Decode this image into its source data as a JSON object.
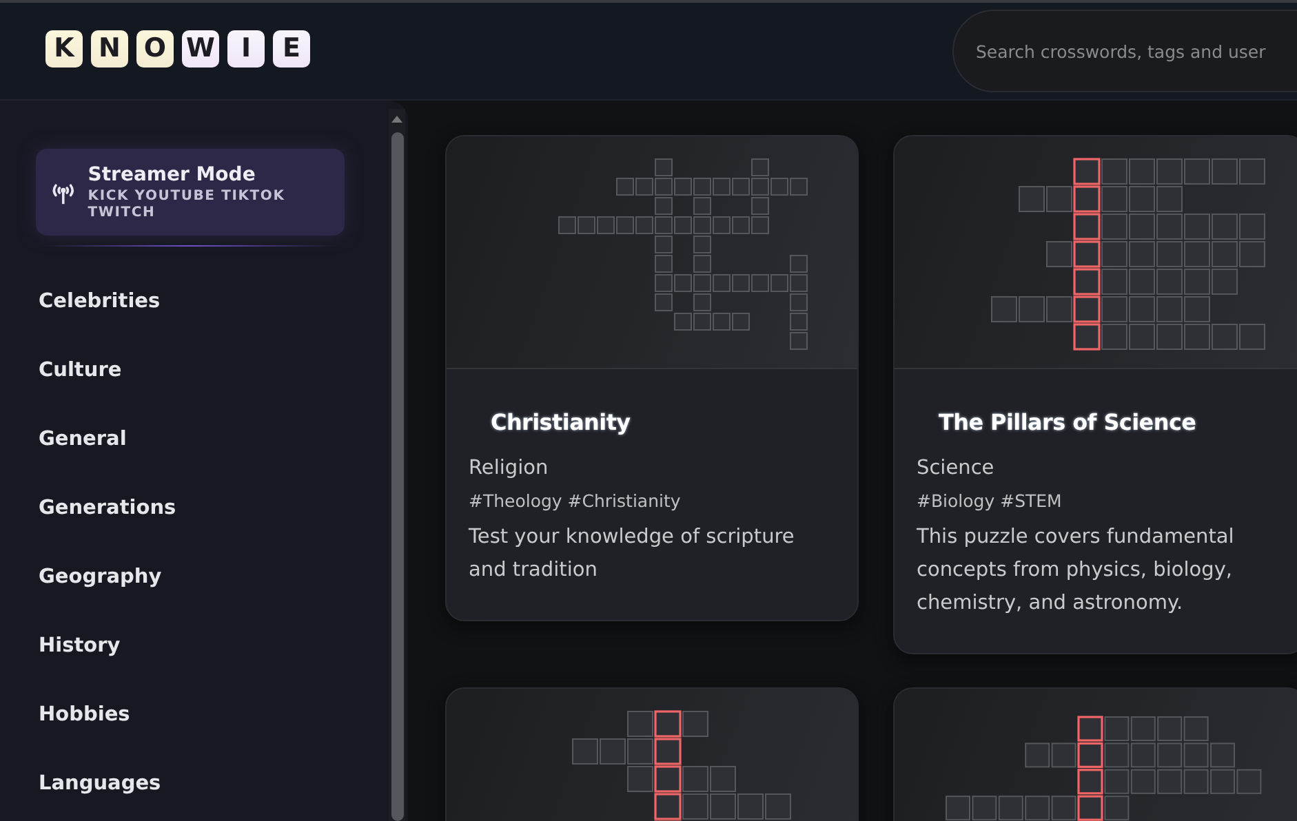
{
  "header": {
    "logo_letters": [
      "K",
      "N",
      "O",
      "W",
      "I",
      "E"
    ],
    "search": {
      "placeholder": "Search crosswords, tags and user"
    }
  },
  "sidebar": {
    "streamer_mode": {
      "title": "Streamer Mode",
      "platforms": "KICK YOUTUBE TIKTOK TWITCH"
    },
    "categories": [
      "Celebrities",
      "Culture",
      "General",
      "Generations",
      "Geography",
      "History",
      "Hobbies",
      "Languages"
    ]
  },
  "cards": [
    {
      "title": "Christianity",
      "category": "Religion",
      "tags": "#Theology #Christianity",
      "description": "Test your knowledge of scripture and tradition",
      "highlighted_column": false
    },
    {
      "title": "The Pillars of Science",
      "category": "Science",
      "tags": "#Biology #STEM",
      "description": "This puzzle covers fundamental concepts from physics, biology, chemistry, and astronomy.",
      "highlighted_column": true
    },
    {
      "highlighted_column": true
    },
    {
      "highlighted_column": true
    }
  ]
}
